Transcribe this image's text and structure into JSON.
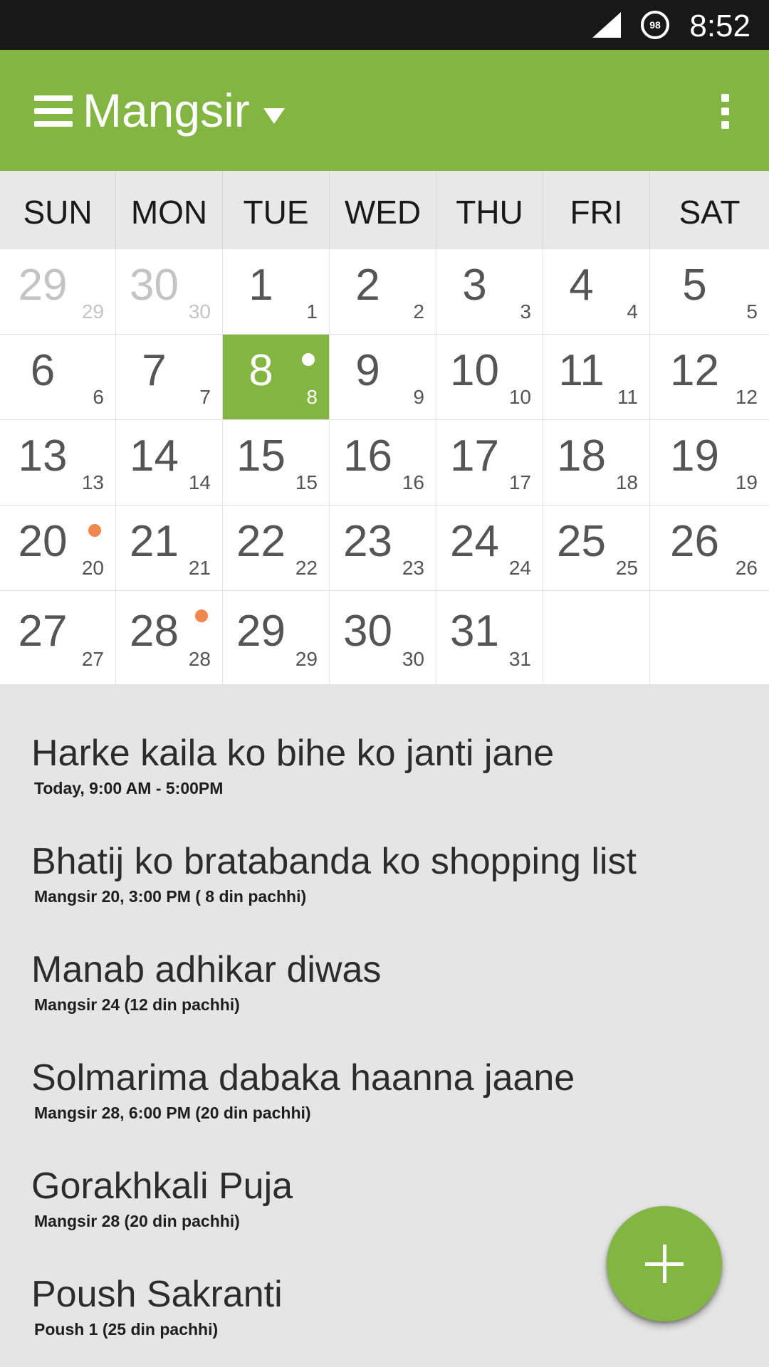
{
  "status_bar": {
    "battery_level": "98",
    "time": "8:52"
  },
  "app_bar": {
    "title": "Mangsir",
    "icons": [
      "menu-icon",
      "chevron-down-icon",
      "overflow-menu-icon"
    ]
  },
  "weekdays": [
    "SUN",
    "MON",
    "TUE",
    "WED",
    "THU",
    "FRI",
    "SAT"
  ],
  "calendar": {
    "days": [
      {
        "day": "29",
        "sub": "29",
        "muted": true
      },
      {
        "day": "30",
        "sub": "30",
        "muted": true
      },
      {
        "day": "1",
        "sub": "1"
      },
      {
        "day": "2",
        "sub": "2"
      },
      {
        "day": "3",
        "sub": "3"
      },
      {
        "day": "4",
        "sub": "4"
      },
      {
        "day": "5",
        "sub": "5"
      },
      {
        "day": "6",
        "sub": "6"
      },
      {
        "day": "7",
        "sub": "7"
      },
      {
        "day": "8",
        "sub": "8",
        "today": true,
        "dot": "#ffffff"
      },
      {
        "day": "9",
        "sub": "9"
      },
      {
        "day": "10",
        "sub": "10"
      },
      {
        "day": "11",
        "sub": "11"
      },
      {
        "day": "12",
        "sub": "12"
      },
      {
        "day": "13",
        "sub": "13"
      },
      {
        "day": "14",
        "sub": "14"
      },
      {
        "day": "15",
        "sub": "15"
      },
      {
        "day": "16",
        "sub": "16"
      },
      {
        "day": "17",
        "sub": "17"
      },
      {
        "day": "18",
        "sub": "18"
      },
      {
        "day": "19",
        "sub": "19"
      },
      {
        "day": "20",
        "sub": "20",
        "dot": "#f0874f"
      },
      {
        "day": "21",
        "sub": "21"
      },
      {
        "day": "22",
        "sub": "22"
      },
      {
        "day": "23",
        "sub": "23"
      },
      {
        "day": "24",
        "sub": "24"
      },
      {
        "day": "25",
        "sub": "25"
      },
      {
        "day": "26",
        "sub": "26"
      },
      {
        "day": "27",
        "sub": "27"
      },
      {
        "day": "28",
        "sub": "28",
        "dot": "#f0874f"
      },
      {
        "day": "29",
        "sub": "29"
      },
      {
        "day": "30",
        "sub": "30"
      },
      {
        "day": "31",
        "sub": "31"
      },
      {
        "day": "",
        "sub": ""
      },
      {
        "day": "",
        "sub": ""
      }
    ]
  },
  "events": [
    {
      "title": "Harke kaila ko bihe ko janti jane",
      "subtitle": "Today, 9:00 AM - 5:00PM"
    },
    {
      "title": "Bhatij ko bratabanda ko shopping list",
      "subtitle": "Mangsir 20, 3:00 PM ( 8 din pachhi)"
    },
    {
      "title": "Manab adhikar diwas",
      "subtitle": "Mangsir 24 (12 din pachhi)"
    },
    {
      "title": "Solmarima dabaka haanna jaane",
      "subtitle": "Mangsir 28, 6:00 PM (20 din pachhi)"
    },
    {
      "title": "Gorakhkali Puja",
      "subtitle": "Mangsir 28 (20 din pachhi)"
    },
    {
      "title": "Poush Sakranti",
      "subtitle": "Poush 1 (25 din pachhi)"
    }
  ],
  "fab": {
    "icon": "plus-icon"
  },
  "colors": {
    "accent": "#82b541",
    "event_dot": "#f0874f",
    "status_bar": "#181818"
  }
}
